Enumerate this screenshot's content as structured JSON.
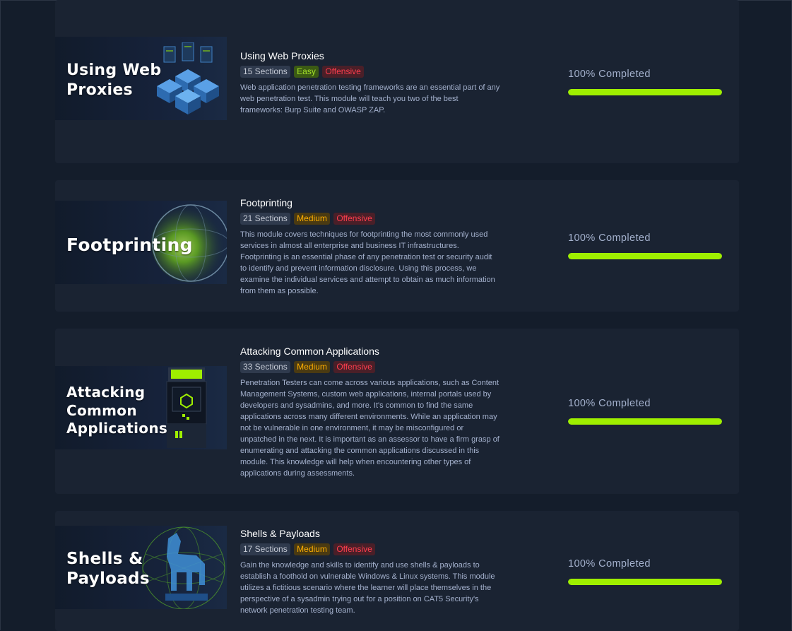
{
  "colors": {
    "background": "#141d2b",
    "card": "#1a2332",
    "accent_green": "#9fef00",
    "medium": "#ffaf00",
    "offensive": "#ff3e4e"
  },
  "modules": [
    {
      "thumb_title": "Using Web\nProxies",
      "thumb_icon": "server-stack-icon",
      "title": "Using Web Proxies",
      "sections": "15 Sections",
      "difficulty": "Easy",
      "category": "Offensive",
      "description": "Web application penetration testing frameworks are an essential part of any web penetration test. This module will teach you two of the best frameworks: Burp Suite and OWASP ZAP.",
      "progress_label": "100% Completed",
      "progress": 1.0
    },
    {
      "thumb_title": "Footprinting",
      "thumb_icon": "globe-icon",
      "title": "Footprinting",
      "sections": "21 Sections",
      "difficulty": "Medium",
      "category": "Offensive",
      "description": "This module covers techniques for footprinting the most commonly used services in almost all enterprise and business IT infrastructures. Footprinting is an essential phase of any penetration test or security audit to identify and prevent information disclosure. Using this process, we examine the individual services and attempt to obtain as much information from them as possible.",
      "progress_label": "100% Completed",
      "progress": 1.0
    },
    {
      "thumb_title": "Attacking\nCommon\nApplications",
      "thumb_icon": "arcade-cabinet-icon",
      "title": "Attacking Common Applications",
      "sections": "33 Sections",
      "difficulty": "Medium",
      "category": "Offensive",
      "description": "Penetration Testers can come across various applications, such as Content Management Systems, custom web applications, internal portals used by developers and sysadmins, and more. It's common to find the same applications across many different environments. While an application may not be vulnerable in one environment, it may be misconfigured or unpatched in the next. It is important as an assessor to have a firm grasp of enumerating and attacking the common applications discussed in this module. This knowledge will help when encountering other types of applications during assessments.",
      "progress_label": "100% Completed",
      "progress": 1.0
    },
    {
      "thumb_title": "Shells &\nPayloads",
      "thumb_icon": "trojan-horse-icon",
      "title": "Shells & Payloads",
      "sections": "17 Sections",
      "difficulty": "Medium",
      "category": "Offensive",
      "description": "Gain the knowledge and skills to identify and use shells & payloads to establish a foothold on vulnerable Windows & Linux systems. This module utilizes a fictitious scenario where the learner will place themselves in the perspective of a sysadmin trying out for a position on CAT5 Security's network penetration testing team.",
      "progress_label": "100% Completed",
      "progress": 1.0
    }
  ]
}
